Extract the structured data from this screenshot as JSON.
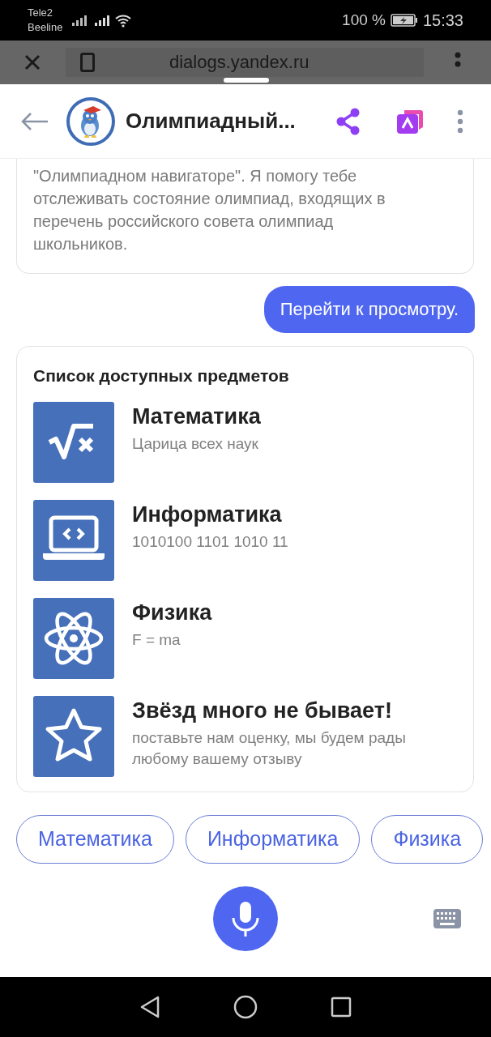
{
  "status_bar": {
    "carriers": [
      "Tele2",
      "Beeline"
    ],
    "battery": "100 %",
    "time": "15:33"
  },
  "browser": {
    "url": "dialogs.yandex.ru"
  },
  "header": {
    "title": "Олимпиадный..."
  },
  "messages": [
    {
      "kind": "bot",
      "text": "\"Олимпиадном навигаторе\". Я помогу тебе отслеживать состояние олимпиад, входящих в перечень российского совета олимпиад школьников."
    },
    {
      "kind": "user",
      "text": "Перейти к просмотру."
    }
  ],
  "card": {
    "title": "Список доступных предметов",
    "items": [
      {
        "kind": "sqrt",
        "title": "Математика",
        "subtitle": "Царица всех наук"
      },
      {
        "kind": "laptop",
        "title": "Информатика",
        "subtitle": "1010100 1101 1010 11"
      },
      {
        "kind": "atom",
        "title": "Физика",
        "subtitle": "F = ma"
      },
      {
        "kind": "star",
        "title": "Звёзд много не бывает!",
        "subtitle": "поставьте нам оценку, мы будем рады любому вашему отзыву"
      }
    ]
  },
  "suggestions": [
    "Математика",
    "Информатика",
    "Физика"
  ]
}
